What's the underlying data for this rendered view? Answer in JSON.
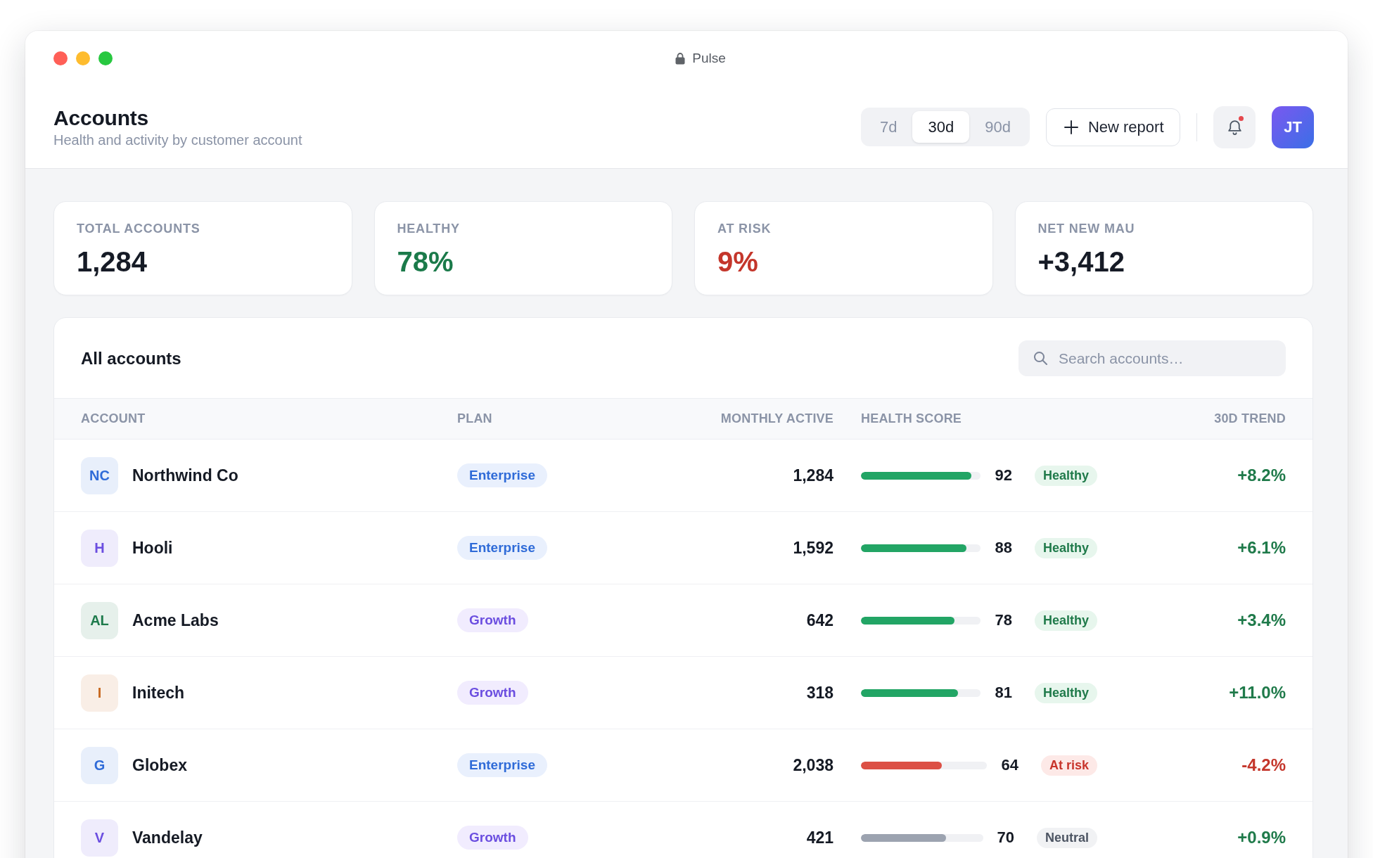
{
  "window": {
    "title": "Pulse"
  },
  "header": {
    "title": "Accounts",
    "subtitle": "Health and activity by customer account"
  },
  "range_tabs": [
    {
      "label": "7d",
      "selected": false
    },
    {
      "label": "30d",
      "selected": true
    },
    {
      "label": "90d",
      "selected": false
    }
  ],
  "new_report_button": {
    "label": "New report"
  },
  "notifications": {
    "unread": true
  },
  "user_avatar": {
    "initials": "JT"
  },
  "stats": [
    {
      "label": "TOTAL ACCOUNTS",
      "value": "1,284",
      "color": "#161b26"
    },
    {
      "label": "HEALTHY",
      "value": "78%",
      "color": "#1b7a4a"
    },
    {
      "label": "AT RISK",
      "value": "9%",
      "color": "#c4362b"
    },
    {
      "label": "NET NEW MAU",
      "value": "+3,412",
      "color": "#161b26"
    }
  ],
  "accounts_table": {
    "title": "All accounts",
    "search": {
      "placeholder": "Search accounts…"
    },
    "columns": [
      "ACCOUNT",
      "PLAN",
      "MONTHLY ACTIVE",
      "HEALTH SCORE",
      "30D TREND"
    ],
    "rows": [
      {
        "avatar": {
          "initials": "NC",
          "color": "#2f6bd8"
        },
        "name": "Northwind Co",
        "plan": {
          "label": "Enterprise",
          "kind": "enterprise"
        },
        "monthly_active": "1,284",
        "health": {
          "level": 0.92,
          "score": "92",
          "status": "Healthy",
          "kind": "healthy"
        },
        "trend": {
          "value": "+8.2%",
          "kind": "up"
        }
      },
      {
        "avatar": {
          "initials": "H",
          "color": "#6b4ee0"
        },
        "name": "Hooli",
        "plan": {
          "label": "Enterprise",
          "kind": "enterprise"
        },
        "monthly_active": "1,592",
        "health": {
          "level": 0.88,
          "score": "88",
          "status": "Healthy",
          "kind": "healthy"
        },
        "trend": {
          "value": "+6.1%",
          "kind": "up"
        }
      },
      {
        "avatar": {
          "initials": "AL",
          "color": "#1d7a4b"
        },
        "name": "Acme Labs",
        "plan": {
          "label": "Growth",
          "kind": "growth"
        },
        "monthly_active": "642",
        "health": {
          "level": 0.78,
          "score": "78",
          "status": "Healthy",
          "kind": "healthy"
        },
        "trend": {
          "value": "+3.4%",
          "kind": "up"
        }
      },
      {
        "avatar": {
          "initials": "I",
          "color": "#c8681f"
        },
        "name": "Initech",
        "plan": {
          "label": "Growth",
          "kind": "growth"
        },
        "monthly_active": "318",
        "health": {
          "level": 0.81,
          "score": "81",
          "status": "Healthy",
          "kind": "healthy"
        },
        "trend": {
          "value": "+11.0%",
          "kind": "up"
        }
      },
      {
        "avatar": {
          "initials": "G",
          "color": "#2f6bd8"
        },
        "name": "Globex",
        "plan": {
          "label": "Enterprise",
          "kind": "enterprise"
        },
        "monthly_active": "2,038",
        "health": {
          "level": 0.64,
          "score": "64",
          "status": "At risk",
          "kind": "risk"
        },
        "trend": {
          "value": "-4.2%",
          "kind": "down"
        }
      },
      {
        "avatar": {
          "initials": "V",
          "color": "#6b4ee0"
        },
        "name": "Vandelay",
        "plan": {
          "label": "Growth",
          "kind": "growth"
        },
        "monthly_active": "421",
        "health": {
          "level": 0.7,
          "score": "70",
          "status": "Neutral",
          "kind": "neutral"
        },
        "trend": {
          "value": "+0.9%",
          "kind": "up"
        }
      }
    ]
  }
}
